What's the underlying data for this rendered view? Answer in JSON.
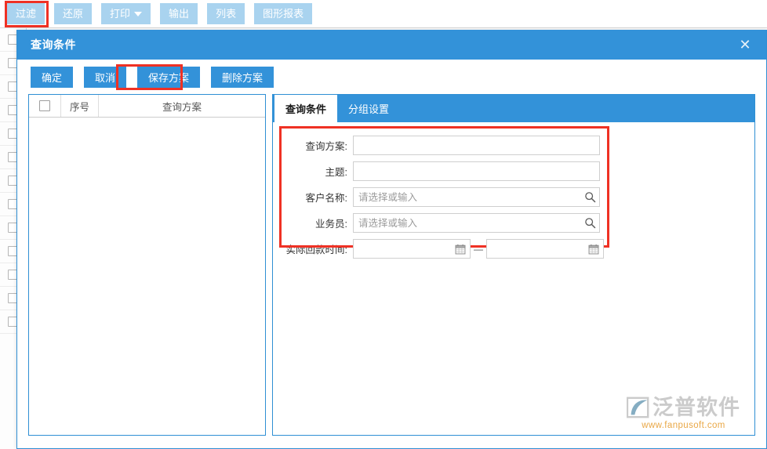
{
  "toolbar": {
    "buttons": [
      {
        "label": "过滤",
        "icon": "filter-icon",
        "highlighted": true,
        "has_caret": false
      },
      {
        "label": "还原",
        "icon": "restore-icon",
        "highlighted": false,
        "has_caret": false
      },
      {
        "label": "打印",
        "icon": "print-icon",
        "highlighted": false,
        "has_caret": true
      },
      {
        "label": "输出",
        "icon": "export-icon",
        "highlighted": false,
        "has_caret": false
      },
      {
        "label": "列表",
        "icon": "list-icon",
        "highlighted": false,
        "has_caret": false
      },
      {
        "label": "图形报表",
        "icon": "chart-report-icon",
        "highlighted": false,
        "has_caret": false
      }
    ],
    "button_bg": "#a9d3ef",
    "highlight_color": "#ef3124"
  },
  "dialog": {
    "title": "查询条件",
    "close_icon": "close-icon",
    "header_bg": "#3392d9",
    "border_color": "#2f8fd4",
    "actions": [
      {
        "label": "确定",
        "highlighted": false
      },
      {
        "label": "取消",
        "highlighted": false
      },
      {
        "label": "保存方案",
        "highlighted": true
      },
      {
        "label": "删除方案",
        "highlighted": false
      }
    ]
  },
  "scheme_panel": {
    "columns": [
      {
        "type": "checkbox",
        "label": ""
      },
      {
        "type": "text",
        "label": "序号"
      },
      {
        "type": "text",
        "label": "查询方案"
      }
    ],
    "rows": []
  },
  "tabs": [
    {
      "label": "查询条件",
      "active": true
    },
    {
      "label": "分组设置",
      "active": false
    }
  ],
  "form": {
    "fields": [
      {
        "label": "查询方案:",
        "value": "",
        "placeholder": "",
        "icon": "",
        "type": "text"
      },
      {
        "label": "主题:",
        "value": "",
        "placeholder": "",
        "icon": "",
        "type": "text"
      },
      {
        "label": "客户名称:",
        "value": "",
        "placeholder": "请选择或输入",
        "icon": "search-icon",
        "type": "lookup"
      },
      {
        "label": "业务员:",
        "value": "",
        "placeholder": "请选择或输入",
        "icon": "search-icon",
        "type": "lookup"
      }
    ],
    "date_range": {
      "label": "实际回款时间:",
      "start_value": "",
      "start_placeholder": "",
      "end_value": "",
      "end_placeholder": "",
      "separator": "—",
      "icon": "calendar-icon"
    }
  },
  "watermark": {
    "brand": "泛普软件",
    "url": "www.fanpusoft.com",
    "logo_icon": "fanpu-logo-icon"
  },
  "background_list": {
    "row_count": 13,
    "checkbox_icon": "row-checkbox"
  }
}
